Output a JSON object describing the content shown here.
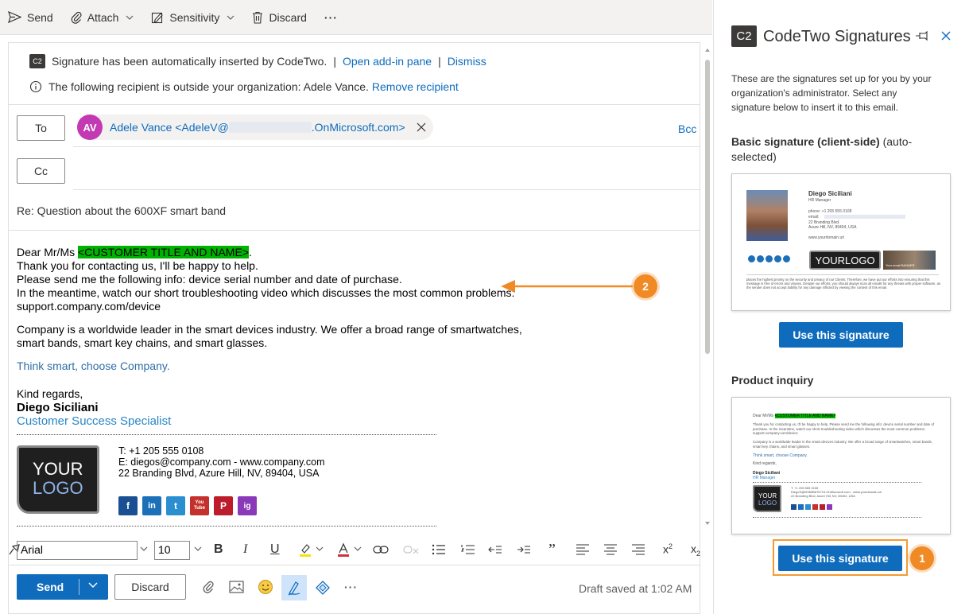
{
  "toolbar": {
    "send": "Send",
    "attach": "Attach",
    "sensitivity": "Sensitivity",
    "discard": "Discard",
    "more": "···"
  },
  "info": {
    "signature_msg": "Signature has been automatically inserted by CodeTwo.",
    "sep1": "|",
    "open_pane": "Open add-in pane",
    "sep2": "|",
    "dismiss": "Dismiss",
    "recipient_msg": "The following recipient is outside your organization: Adele Vance.",
    "remove_recipient": "Remove recipient",
    "c2_badge": "C2"
  },
  "to": {
    "label": "To",
    "avatar": "AV",
    "name_prefix": "Adele Vance <AdeleV@",
    "name_suffix": ".OnMicrosoft.com>",
    "bcc": "Bcc"
  },
  "cc": {
    "label": "Cc"
  },
  "subject": "Re: Question about the 600XF smart band",
  "body": {
    "greeting_prefix": "Dear Mr/Ms ",
    "placeholder": "<CUSTOMER TITLE AND NAME>",
    "greeting_suffix": ".",
    "line1": "Thank you for contacting us, I'll be happy to help.",
    "line2": "Please send me the following info: device serial number and date of purchase.",
    "line3": "In the meantime, watch our short troubleshooting video which discusses the most common problems:",
    "line4": "support.company.com/device",
    "para2a": "Company is a worldwide leader in the smart devices industry. We offer a broad range of smartwatches,",
    "para2b": "smart bands, smart key chains, and smart glasses.",
    "tagline": "Think smart, choose Company.",
    "regards": "Kind regards,",
    "sig_name": "Diego Siciliani",
    "sig_title": "Customer Success Specialist",
    "logo_line1": "YOUR",
    "logo_line2": "LOGO",
    "phone": "T: +1 205 555 0108",
    "email": "E: diegos@company.com - www.company.com",
    "address": "22 Branding Blvd, Azure Hill, NV, 89404, USA",
    "socials": [
      "f",
      "in",
      "t",
      "You Tube",
      "P",
      "ig"
    ]
  },
  "format": {
    "font": "Arial",
    "size": "10"
  },
  "bottom": {
    "send": "Send",
    "discard": "Discard",
    "draft_status": "Draft saved at 1:02 AM"
  },
  "pane": {
    "logo": "C2",
    "title": "CodeTwo Signatures",
    "description": "These are the signatures set up for you by your organization's administrator. Select any signature below to insert it to this email.",
    "sig1_title": "Basic signature (client-side)",
    "sig1_suffix": " (auto-selected)",
    "sig1_preview": {
      "name": "Diego Siciliani",
      "role": "HR Manager",
      "phone": "phone: +1 205 555 0108",
      "email": "email:",
      "addr1": "22 Branding Blvd.",
      "addr2": "Azure Hill, NV, 89404, USA",
      "web": "www.yourdomain.url",
      "logo": "YOURLOGO",
      "banner": "Your email BANNER",
      "disclaimer": "places the highest priority on the security and privacy of our Clients. Therefore, we have put our efforts into ensuring that this message is free of errors and viruses. Despite our efforts, you should always scan all emails for any threats with proper software, as the sender does not accept liability for any damage inflicted by viewing the content of this email."
    },
    "use_button": "Use this signature",
    "sig2_title": "Product inquiry",
    "sig2_preview": {
      "greeting": "Dear Mr/Ms",
      "placeholder": "<CUSTOMER TITLE AND NAME>",
      "p1": "Thank you for contacting us, I'll be happy to help. Please send me the following info: device serial number and date of purchase. In the meantime, watch our short troubleshooting video which discusses the most common problems: support.company.com/device",
      "p2": "Company is a worldwide leader in the smart devices industry. We offer a broad range of smartwatches, smart bands, smart key chains, and smart glasses.",
      "tag": "Think smart, choose Company.",
      "regards": "Kind regards,",
      "name": "Diego Siciliani",
      "role": "HR Manager",
      "contact1": "T: +1 205 555 0108",
      "contact2": "DiegoS@M365B876719.OnMicrosoft.com - www.yourdomain.url",
      "contact3": "22 Branding Blvd, Azure Hill, NV, 89404, USA",
      "logo1": "YOUR",
      "logo2": "LOGO"
    },
    "use_button2": "Use this signature"
  },
  "badges": {
    "one": "1",
    "two": "2"
  },
  "colors": {
    "accent": "#0f6cbd",
    "highlight": "#00b200",
    "callout": "#f08a24",
    "avatar": "#c239b3"
  }
}
